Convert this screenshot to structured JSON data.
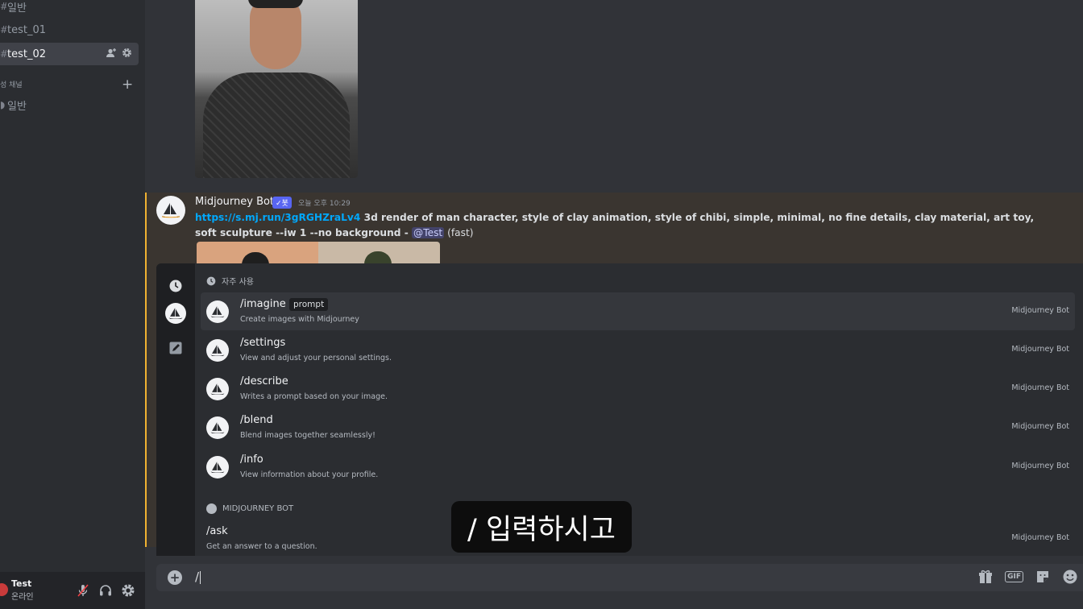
{
  "sidebar": {
    "channels": [
      {
        "label": "일반"
      },
      {
        "label": "test_01"
      },
      {
        "label": "test_02"
      }
    ],
    "voice_category": "성 채널",
    "voice_channel": "일반"
  },
  "user_panel": {
    "name": "Test",
    "status": "온라인"
  },
  "message": {
    "author": "Midjourney Bot",
    "bot_tag": "✓봇",
    "time": "오늘 오후 10:29",
    "link": "https://s.mj.run/3gRGHZraLv4",
    "prompt": " 3d render of man character, style of clay animation, style of chibi, simple, minimal, no fine details, clay material, art toy, soft sculpture --iw 1 --no background - ",
    "mention": "@Test",
    "speed": " (fast)"
  },
  "autocomplete": {
    "frequent_header": "자주 사용",
    "commands": [
      {
        "name": "/imagine",
        "param": "prompt",
        "desc": "Create images with Midjourney",
        "source": "Midjourney Bot"
      },
      {
        "name": "/settings",
        "desc": "View and adjust your personal settings.",
        "source": "Midjourney Bot"
      },
      {
        "name": "/describe",
        "desc": "Writes a prompt based on your image.",
        "source": "Midjourney Bot"
      },
      {
        "name": "/blend",
        "desc": "Blend images together seamlessly!",
        "source": "Midjourney Bot"
      },
      {
        "name": "/info",
        "desc": "View information about your profile.",
        "source": "Midjourney Bot"
      }
    ],
    "bot_header": "MIDJOURNEY BOT",
    "bot_commands": [
      {
        "name": "/ask",
        "desc": "Get an answer to a question.",
        "source": "Midjourney Bot"
      }
    ]
  },
  "subtitle": "/ 입력하시고",
  "input": {
    "value": "/",
    "gif_label": "GIF"
  }
}
